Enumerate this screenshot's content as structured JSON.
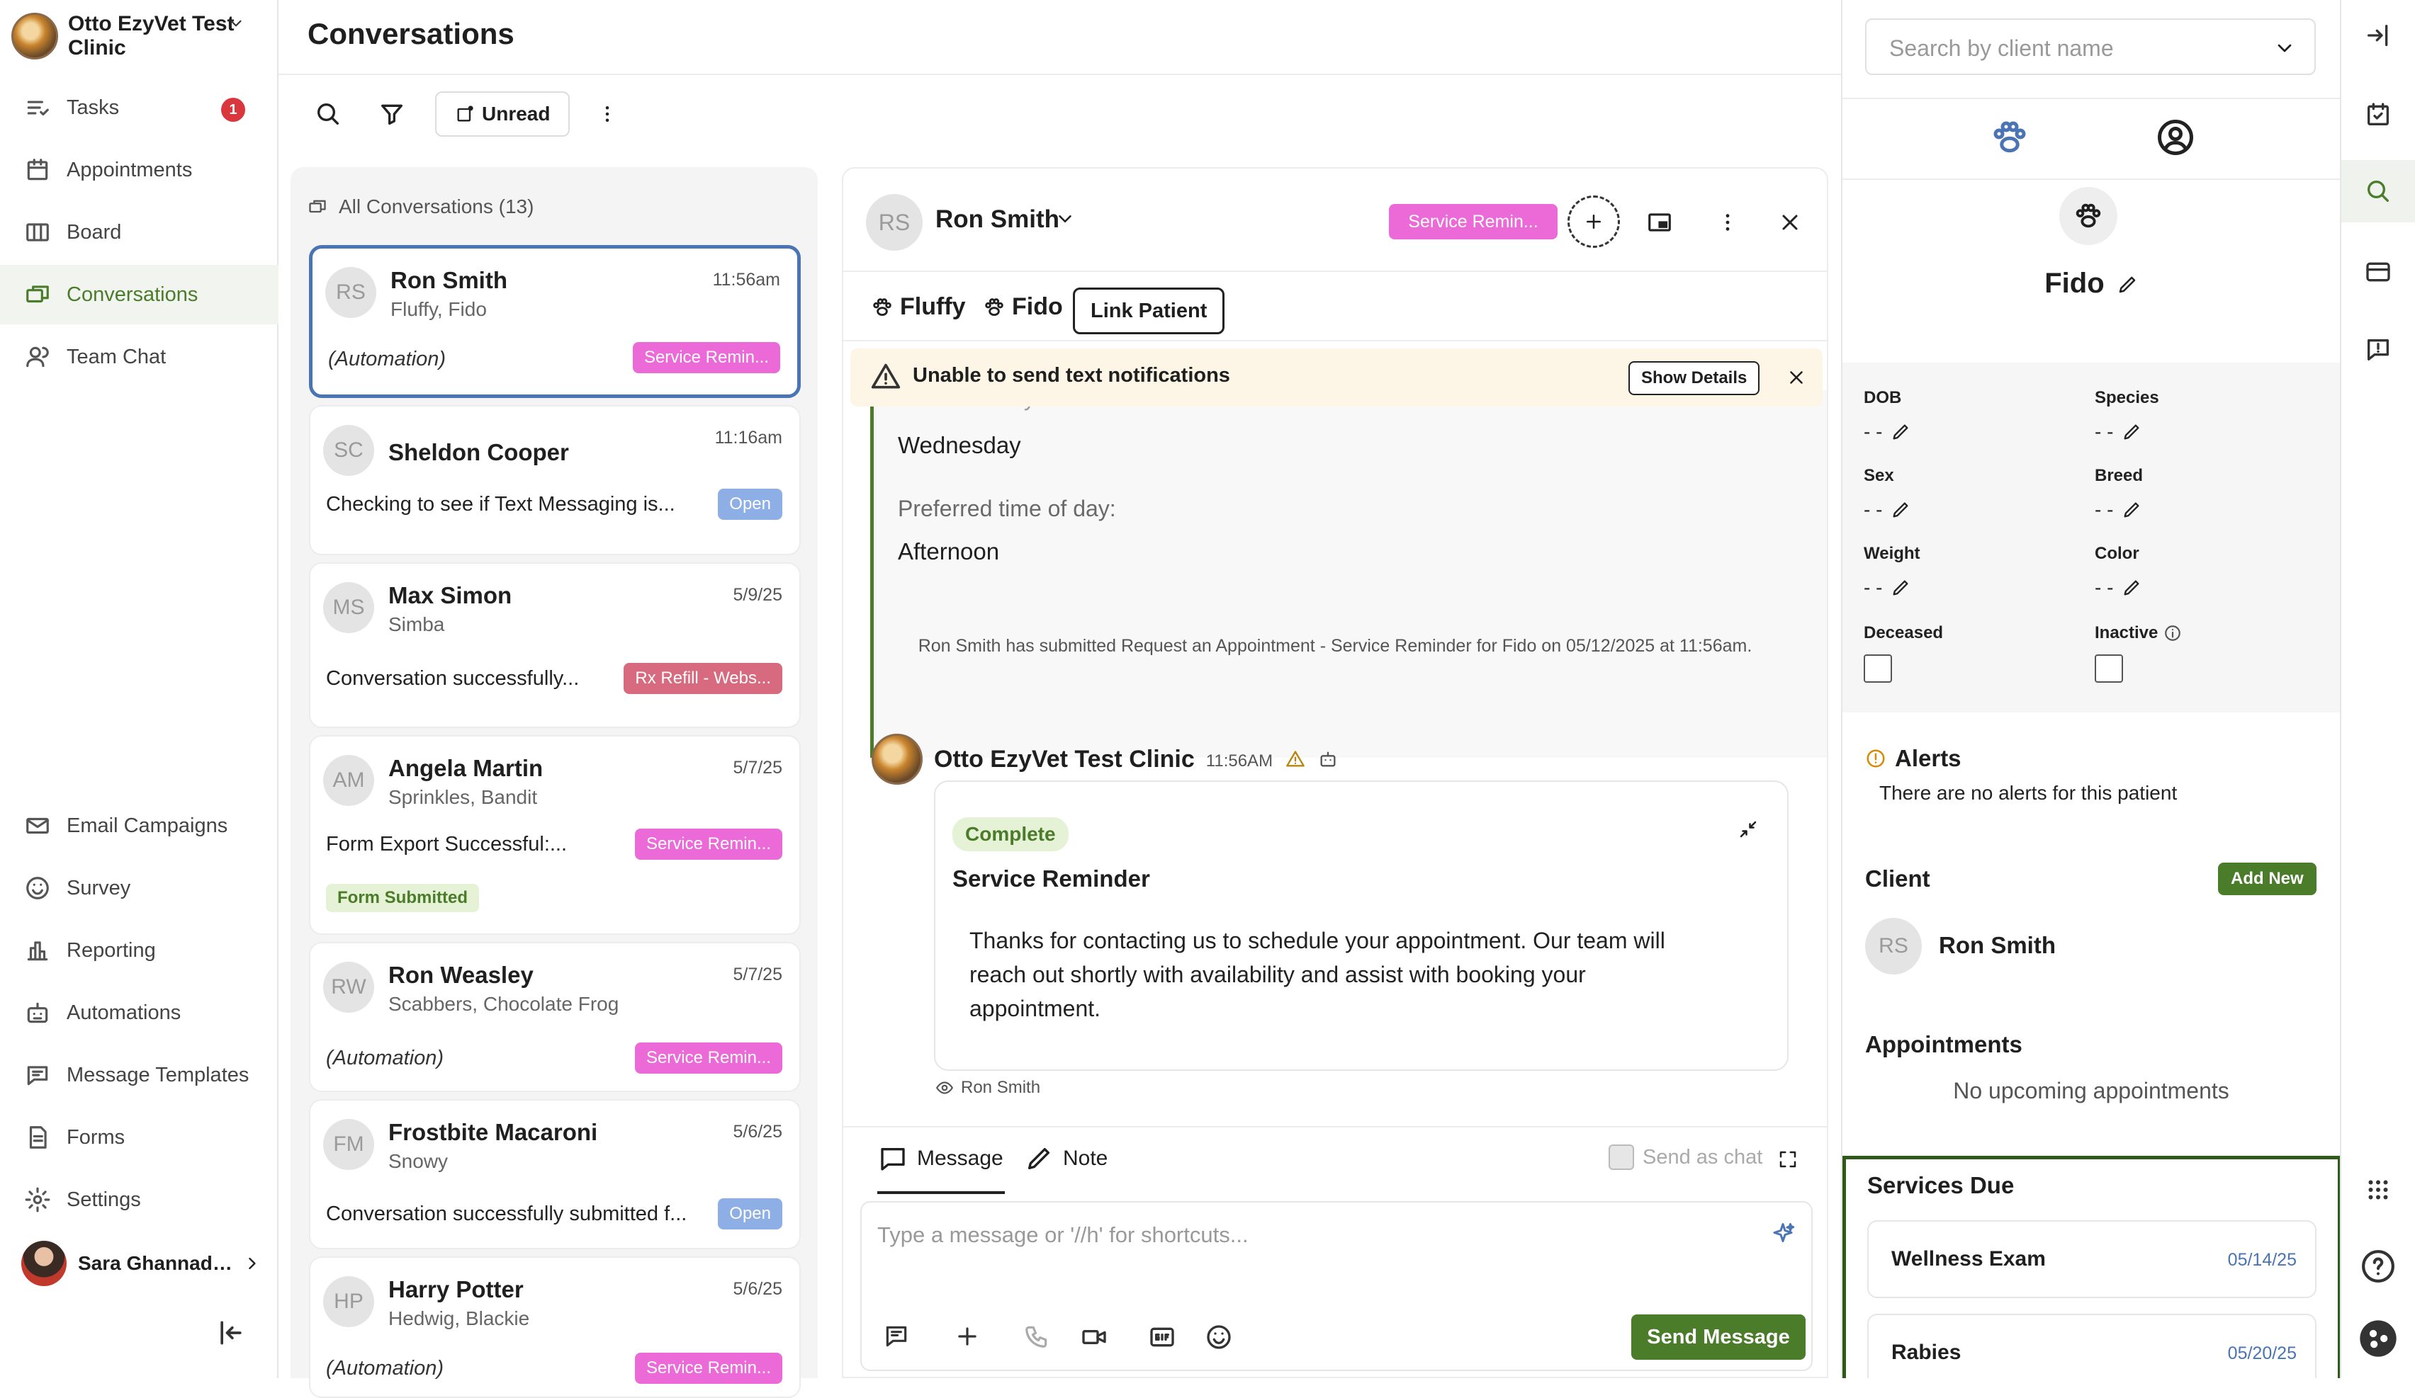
{
  "sidebar": {
    "clinic_name": "Otto EzyVet Test Clinic",
    "tasks_badge": "1",
    "items_top": [
      {
        "label": "Tasks",
        "icon": "tasks-icon"
      },
      {
        "label": "Appointments",
        "icon": "calendar-icon"
      },
      {
        "label": "Board",
        "icon": "board-icon"
      },
      {
        "label": "Conversations",
        "icon": "conversations-icon",
        "active": true
      },
      {
        "label": "Team Chat",
        "icon": "team-chat-icon"
      }
    ],
    "items_bottom": [
      {
        "label": "Email Campaigns",
        "icon": "email-icon"
      },
      {
        "label": "Survey",
        "icon": "survey-icon"
      },
      {
        "label": "Reporting",
        "icon": "reporting-icon"
      },
      {
        "label": "Automations",
        "icon": "automations-icon"
      },
      {
        "label": "Message Templates",
        "icon": "templates-icon"
      },
      {
        "label": "Forms",
        "icon": "forms-icon"
      },
      {
        "label": "Settings",
        "icon": "settings-icon"
      }
    ],
    "user_name": "Sara Ghannadian"
  },
  "header": {
    "title": "Conversations",
    "unread_label": "Unread"
  },
  "list": {
    "heading": "All Conversations (13)",
    "conversations": [
      {
        "initials": "RS",
        "name": "Ron Smith",
        "pets": "Fluffy, Fido",
        "time": "11:56am",
        "preview": "(Automation)",
        "tag": "Service Remin...",
        "tag_color": "pink"
      },
      {
        "initials": "SC",
        "name": "Sheldon Cooper",
        "pets": "",
        "time": "11:16am",
        "preview": "Checking to see if Text Messaging is...",
        "tag": "Open",
        "tag_color": "blue"
      },
      {
        "initials": "MS",
        "name": "Max Simon",
        "pets": "Simba",
        "time": "5/9/25",
        "preview": "Conversation successfully...",
        "tag": "Rx Refill - Webs...",
        "tag_color": "red"
      },
      {
        "initials": "AM",
        "name": "Angela Martin",
        "pets": "Sprinkles, Bandit",
        "time": "5/7/25",
        "preview": "Form Export Successful:...",
        "tag": "Service Remin...",
        "tag_color": "pink",
        "extra_tag": "Form Submitted"
      },
      {
        "initials": "RW",
        "name": "Ron Weasley",
        "pets": "Scabbers, Chocolate Frog",
        "time": "5/7/25",
        "preview": "(Automation)",
        "tag": "Service Remin...",
        "tag_color": "pink"
      },
      {
        "initials": "FM",
        "name": "Frostbite Macaroni",
        "pets": "Snowy",
        "time": "5/6/25",
        "preview": "Conversation successfully submitted f...",
        "tag": "Open",
        "tag_color": "blue"
      },
      {
        "initials": "HP",
        "name": "Harry Potter",
        "pets": "Hedwig, Blackie",
        "time": "5/6/25",
        "preview": "(Automation)",
        "tag": "Service Remin...",
        "tag_color": "pink"
      }
    ]
  },
  "chat": {
    "initials": "RS",
    "name": "Ron Smith",
    "tag": "Service Remin...",
    "pets": [
      "Fluffy",
      "Fido"
    ],
    "link_patient": "Link Patient",
    "warning": "Unable to send text notifications",
    "show_details": "Show Details",
    "form_partial_label": "Preferred days:",
    "form_day": "Wednesday",
    "form_time_label": "Preferred time of day:",
    "form_time": "Afternoon",
    "system_message": "Ron Smith has submitted Request an Appointment - Service Reminder for Fido on 05/12/2025 at 11:56am.",
    "sender": "Otto EzyVet Test Clinic",
    "sent_time": "11:56AM",
    "status": "Complete",
    "card_title": "Service Reminder",
    "card_body": "Thanks for contacting us to schedule your appointment. Our team will reach out shortly with availability and assist with booking your appointment.",
    "seen_by": "Ron Smith",
    "compose": {
      "tab_message": "Message",
      "tab_note": "Note",
      "send_as_chat": "Send as chat",
      "placeholder": "Type a message or '//h' for shortcuts...",
      "send_label": "Send Message"
    }
  },
  "right": {
    "search_placeholder": "Search by client name",
    "pet_name": "Fido",
    "fields": [
      {
        "label": "DOB",
        "value": "- -"
      },
      {
        "label": "Species",
        "value": "- -"
      },
      {
        "label": "Sex",
        "value": "- -"
      },
      {
        "label": "Breed",
        "value": "- -"
      },
      {
        "label": "Weight",
        "value": "- -"
      },
      {
        "label": "Color",
        "value": "- -"
      }
    ],
    "deceased_label": "Deceased",
    "inactive_label": "Inactive",
    "alerts_title": "Alerts",
    "alerts_text": "There are no alerts for this patient",
    "client_title": "Client",
    "add_new": "Add New",
    "client_initials": "RS",
    "client_name": "Ron Smith",
    "appointments_title": "Appointments",
    "appointments_text": "No upcoming appointments",
    "services_title": "Services Due",
    "services": [
      {
        "name": "Wellness Exam",
        "date": "05/14/25"
      },
      {
        "name": "Rabies",
        "date": "05/20/25"
      }
    ]
  },
  "colors": {
    "brand_green": "#4a7c2a",
    "accent_blue": "#4a74b4",
    "tag_pink": "#ec6ad7",
    "badge_red": "#d9363e"
  }
}
